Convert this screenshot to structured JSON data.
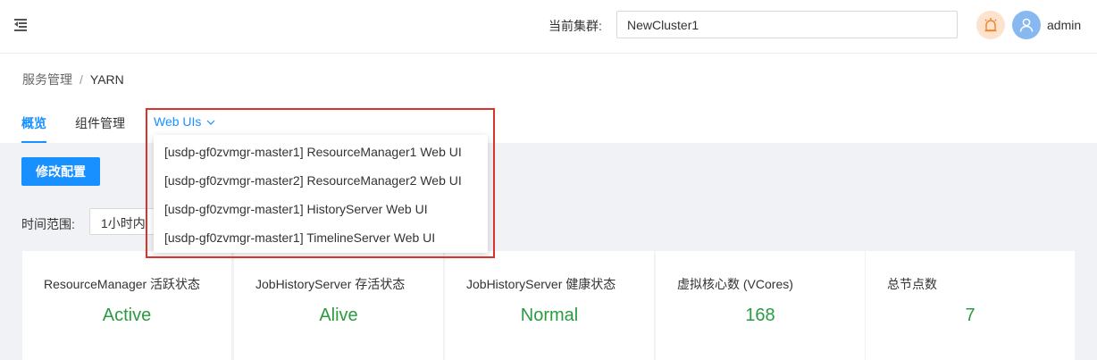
{
  "header": {
    "cluster_label": "当前集群:",
    "cluster_value": "NewCluster1",
    "username": "admin"
  },
  "breadcrumb": {
    "root": "服务管理",
    "separator": "/",
    "current": "YARN"
  },
  "tabs": [
    {
      "label": "概览",
      "active": true
    },
    {
      "label": "组件管理",
      "active": false
    },
    {
      "label": "Web UIs",
      "active": false
    }
  ],
  "toolbar": {
    "modify_config": "修改配置",
    "time_label": "时间范围:",
    "time_value": "1小时内"
  },
  "web_uis_menu": [
    "[usdp-gf0zvmgr-master1] ResourceManager1 Web UI",
    "[usdp-gf0zvmgr-master2] ResourceManager2 Web UI",
    "[usdp-gf0zvmgr-master1] HistoryServer Web UI",
    "[usdp-gf0zvmgr-master1] TimelineServer Web UI"
  ],
  "cards": [
    {
      "title": "ResourceManager 活跃状态",
      "value": "Active"
    },
    {
      "title": "JobHistoryServer 存活状态",
      "value": "Alive"
    },
    {
      "title": "JobHistoryServer 健康状态",
      "value": "Normal"
    },
    {
      "title": "虚拟核心数 (VCores)",
      "value": "168"
    },
    {
      "title": "总节点数",
      "value": "7"
    }
  ],
  "colors": {
    "primary": "#1890ff",
    "status_green": "#2a9b3f",
    "highlight_red": "#d9342b",
    "alarm_bg": "#fde3cf",
    "avatar_bg": "#87b8f0"
  },
  "icons": {
    "menu": "menu-fold-icon",
    "alarm": "alarm-bell-icon",
    "avatar": "user-icon",
    "chevron": "chevron-down-icon"
  }
}
